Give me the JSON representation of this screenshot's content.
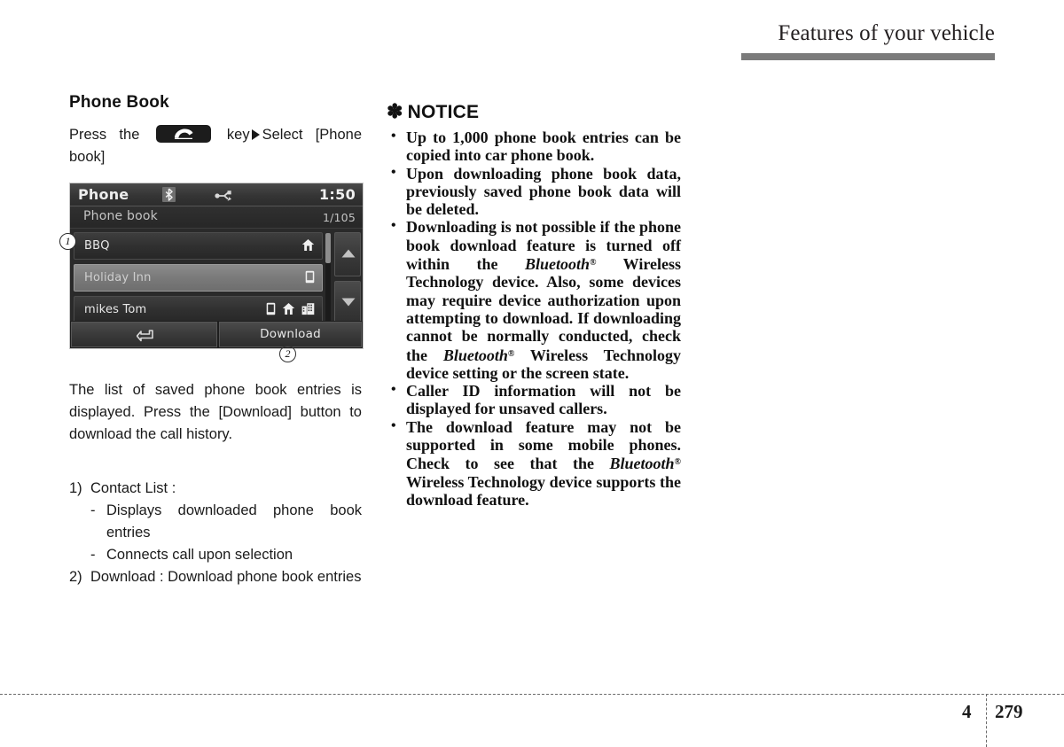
{
  "header": {
    "title": "Features of your vehicle"
  },
  "left": {
    "section_title": "Phone Book",
    "instruction_prefix": "Press  the",
    "instruction_key_label": "key",
    "instruction_suffix": "Select  [Phone book]",
    "description": "The list of saved phone book entries is displayed. Press the [Download] button to download the call history.",
    "legend": [
      {
        "num": "1)",
        "text": "Contact List :",
        "subs": [
          {
            "dash": "-",
            "text": "Displays downloaded phone book entries"
          },
          {
            "dash": "-",
            "text": "Connects call upon selection"
          }
        ]
      },
      {
        "num": "2)",
        "text": "Download : Download phone book entries",
        "subs": []
      }
    ]
  },
  "device": {
    "title": "Phone",
    "clock": "1:50",
    "subtitle": "Phone book",
    "count": "1/105",
    "status_icons": [
      "bluetooth-icon",
      "usb-icon"
    ],
    "contacts": [
      {
        "name": "BBQ",
        "style": "dark",
        "icons": [
          "home-icon"
        ]
      },
      {
        "name": "Holiday Inn",
        "style": "light",
        "icons": [
          "mobile-icon"
        ]
      },
      {
        "name": "mikes Tom",
        "style": "dark",
        "icons": [
          "mobile-icon",
          "home-icon",
          "office-icon"
        ]
      }
    ],
    "back_button_icon": "back-arrow-icon",
    "download_label": "Download",
    "scroll_up_icon": "triangle-up-icon",
    "scroll_down_icon": "triangle-down-icon",
    "callout_1": "1",
    "callout_2": "2"
  },
  "notice": {
    "asterisk": "✽",
    "heading": "NOTICE",
    "bullet": "•",
    "items": [
      {
        "id": "notice-item-1"
      },
      {
        "id": "notice-item-2"
      },
      {
        "id": "notice-item-3"
      },
      {
        "id": "notice-item-4"
      },
      {
        "id": "notice-item-5"
      }
    ],
    "item_1": "Up to 1,000 phone book entries can be copied into car phone book.",
    "item_2": "Upon downloading phone book data, previously saved phone book data will be deleted.",
    "item_3_a": "Downloading is not possible if the phone book download feature is turned off within the ",
    "item_3_bt1": "Bluetooth",
    "item_3_b": " Wireless Technology device. Also, some devices may require device authorization upon attempting to download. If downloading cannot be normally conducted, check the ",
    "item_3_bt2": "Bluetooth",
    "item_3_c": " Wireless Technology device setting or the screen state.",
    "item_4": "Caller ID information will not be displayed for unsaved callers.",
    "item_5_a": "The download feature may not be supported in some mobile phones. Check to see that the ",
    "item_5_bt": "Bluetooth",
    "item_5_b": " Wireless Technology device supports the download feature.",
    "registered_mark": "®"
  },
  "footer": {
    "chapter": "4",
    "page": "279"
  },
  "colors": {
    "header_rule": "#7b7b7b",
    "device_dark": "#2a2a2a",
    "device_light_row": "#7a7a7a",
    "text": "#1a1a1a"
  }
}
